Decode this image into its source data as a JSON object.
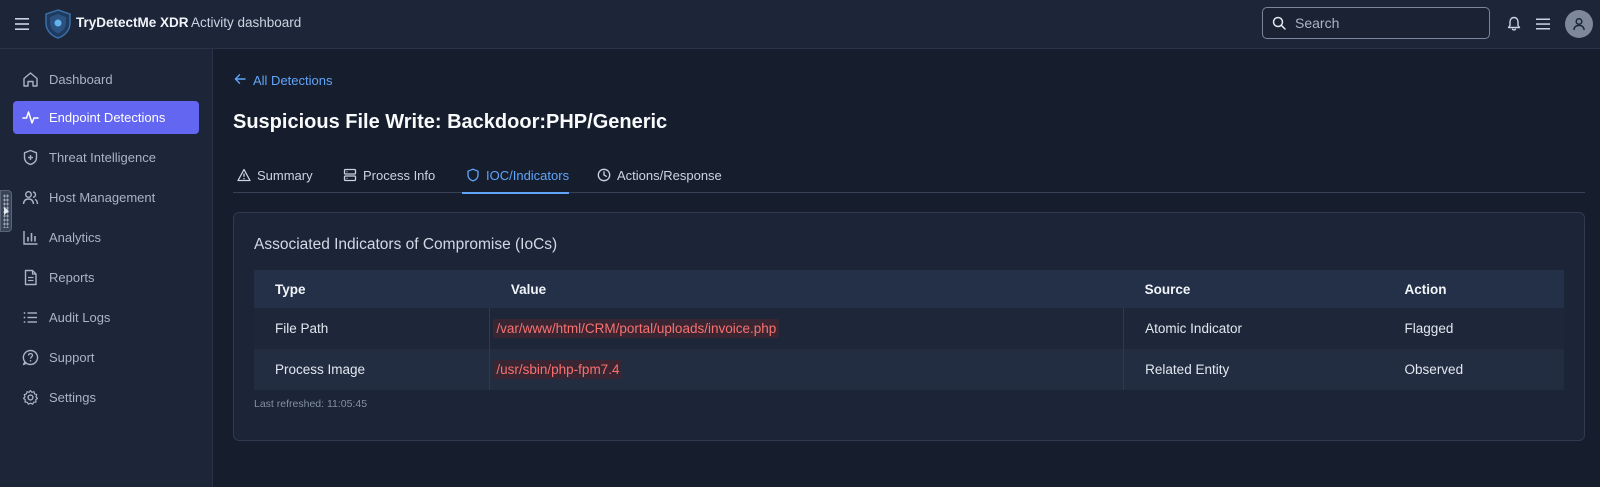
{
  "header": {
    "brand": "TryDetectMe XDR",
    "subtitle": "Activity dashboard",
    "search_placeholder": "Search"
  },
  "sidebar": {
    "items": [
      {
        "label": "Dashboard",
        "icon": "home-icon",
        "active": false
      },
      {
        "label": "Endpoint Detections",
        "icon": "activity-icon",
        "active": true
      },
      {
        "label": "Threat Intelligence",
        "icon": "shield-plus-icon",
        "active": false
      },
      {
        "label": "Host Management",
        "icon": "users-icon",
        "active": false
      },
      {
        "label": "Analytics",
        "icon": "bar-chart-icon",
        "active": false
      },
      {
        "label": "Reports",
        "icon": "file-text-icon",
        "active": false
      },
      {
        "label": "Audit Logs",
        "icon": "list-icon",
        "active": false
      },
      {
        "label": "Support",
        "icon": "help-circle-icon",
        "active": false
      },
      {
        "label": "Settings",
        "icon": "gear-icon",
        "active": false
      }
    ]
  },
  "main": {
    "back_label": "All Detections",
    "title": "Suspicious File Write: Backdoor:PHP/Generic",
    "tabs": [
      {
        "label": "Summary",
        "icon": "warning-icon",
        "active": false
      },
      {
        "label": "Process Info",
        "icon": "server-icon",
        "active": false
      },
      {
        "label": "IOC/Indicators",
        "icon": "shield-icon",
        "active": true
      },
      {
        "label": "Actions/Response",
        "icon": "clock-icon",
        "active": false
      }
    ],
    "panel": {
      "title": "Associated Indicators of Compromise (IoCs)",
      "columns": [
        "Type",
        "Value",
        "Source",
        "Action"
      ],
      "rows": [
        {
          "type": "File Path",
          "value": "/var/www/html/CRM/portal/uploads/invoice.php",
          "source": "Atomic Indicator",
          "action": "Flagged"
        },
        {
          "type": "Process Image",
          "value": "/usr/sbin/php-fpm7.4",
          "source": "Related Entity",
          "action": "Observed"
        }
      ],
      "last_refreshed": "Last refreshed: 11:05:45"
    }
  },
  "colors": {
    "accent": "#6366f1",
    "link": "#60a5fa",
    "code_text": "#f87171",
    "background": "#161d2c"
  }
}
